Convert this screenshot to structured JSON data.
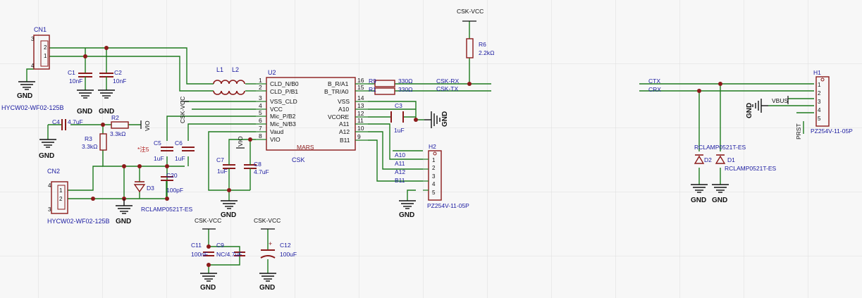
{
  "colors": {
    "background": "#f7f7f7",
    "grid": "#dcdcdc",
    "wire": "#1e7a1e",
    "component": "#8b1a1a",
    "pin_text": "#111111",
    "designator": "#1a1aa0",
    "power": "#111111"
  },
  "connectors": {
    "cn1": {
      "ref": "CN1",
      "part": "HYCW02-WF02-125B",
      "pins": [
        "3",
        "2",
        "1",
        "4"
      ]
    },
    "cn2": {
      "ref": "CN2",
      "part": "HYCW02-WF02-125B",
      "pins": [
        "4",
        "1",
        "2",
        "3"
      ]
    },
    "h2": {
      "ref": "H2",
      "part": "PZ254V-11-05P",
      "pins": [
        "1",
        "2",
        "3",
        "4",
        "5"
      ]
    },
    "h1": {
      "ref": "H1",
      "part": "PZ254V-11-05P",
      "pins": [
        "1",
        "2",
        "3",
        "4",
        "5"
      ]
    }
  },
  "passives": {
    "c1": {
      "ref": "C1",
      "value": "10nF"
    },
    "c2": {
      "ref": "C2",
      "value": "10nF"
    },
    "c3": {
      "ref": "C3",
      "value": "1uF"
    },
    "c4": {
      "ref": "C4",
      "value": "4.7uF"
    },
    "c5": {
      "ref": "C5",
      "value": "1uF"
    },
    "c6": {
      "ref": "C6",
      "value": "1uF"
    },
    "c7": {
      "ref": "C7",
      "value": "1uF"
    },
    "c8": {
      "ref": "C8",
      "value": "4.7uF"
    },
    "c9": {
      "ref": "C9",
      "value": "NC/4.7uF"
    },
    "c11": {
      "ref": "C11",
      "value": "100nF"
    },
    "c12": {
      "ref": "C12",
      "value": "100uF"
    },
    "c20": {
      "ref": "C20",
      "value": "100pF"
    },
    "r1": {
      "ref": "R1",
      "value": "330Ω"
    },
    "r2": {
      "ref": "R2",
      "value": "3.3kΩ"
    },
    "r3": {
      "ref": "R3",
      "value": "3.3kΩ"
    },
    "r6": {
      "ref": "R6",
      "value": "2.2kΩ"
    },
    "r9": {
      "ref": "R9",
      "value": "330Ω"
    },
    "l1": {
      "ref": "L1"
    },
    "l2": {
      "ref": "L2"
    },
    "d1": {
      "ref": "D1",
      "part": "RCLAMP0521T-ES"
    },
    "d2": {
      "ref": "D2",
      "part": "RCLAMP0521T-ES"
    },
    "d3": {
      "ref": "D3",
      "part": "RCLAMP0521T-ES"
    },
    "note": "*注5",
    "c12_plus": "+"
  },
  "ic": {
    "ref": "U2",
    "name": "MARS",
    "sub": "CSK",
    "left_pins": [
      {
        "num": "1",
        "name": "CLD_N/B0"
      },
      {
        "num": "2",
        "name": "CLD_P/B1"
      },
      {
        "num": "3",
        "name": "VSS_CLD"
      },
      {
        "num": "4",
        "name": "VCC"
      },
      {
        "num": "5",
        "name": "Mic_P/B2"
      },
      {
        "num": "6",
        "name": "Mic_N/B3"
      },
      {
        "num": "7",
        "name": "Vaud"
      },
      {
        "num": "8",
        "name": "VIO"
      }
    ],
    "right_pins": [
      {
        "num": "16",
        "name": "B_R/A1"
      },
      {
        "num": "15",
        "name": "B_TR/A0"
      },
      {
        "num": "14",
        "name": "VSS"
      },
      {
        "num": "13",
        "name": "A10"
      },
      {
        "num": "12",
        "name": "VCORE"
      },
      {
        "num": "11",
        "name": "A11"
      },
      {
        "num": "10",
        "name": "A12"
      },
      {
        "num": "9",
        "name": "B11"
      }
    ]
  },
  "nets": {
    "gnd": "GND",
    "csk_vcc": "CSK-VCC",
    "vio": "VIO",
    "vbus": "VBUS",
    "prst": "PRST",
    "csk_rx": "CSK-RX",
    "csk_tx": "CSK-TX",
    "ctx": "CTX",
    "crx": "CRX",
    "a10": "A10",
    "a11": "A11",
    "a12": "A12",
    "b11": "B11"
  }
}
